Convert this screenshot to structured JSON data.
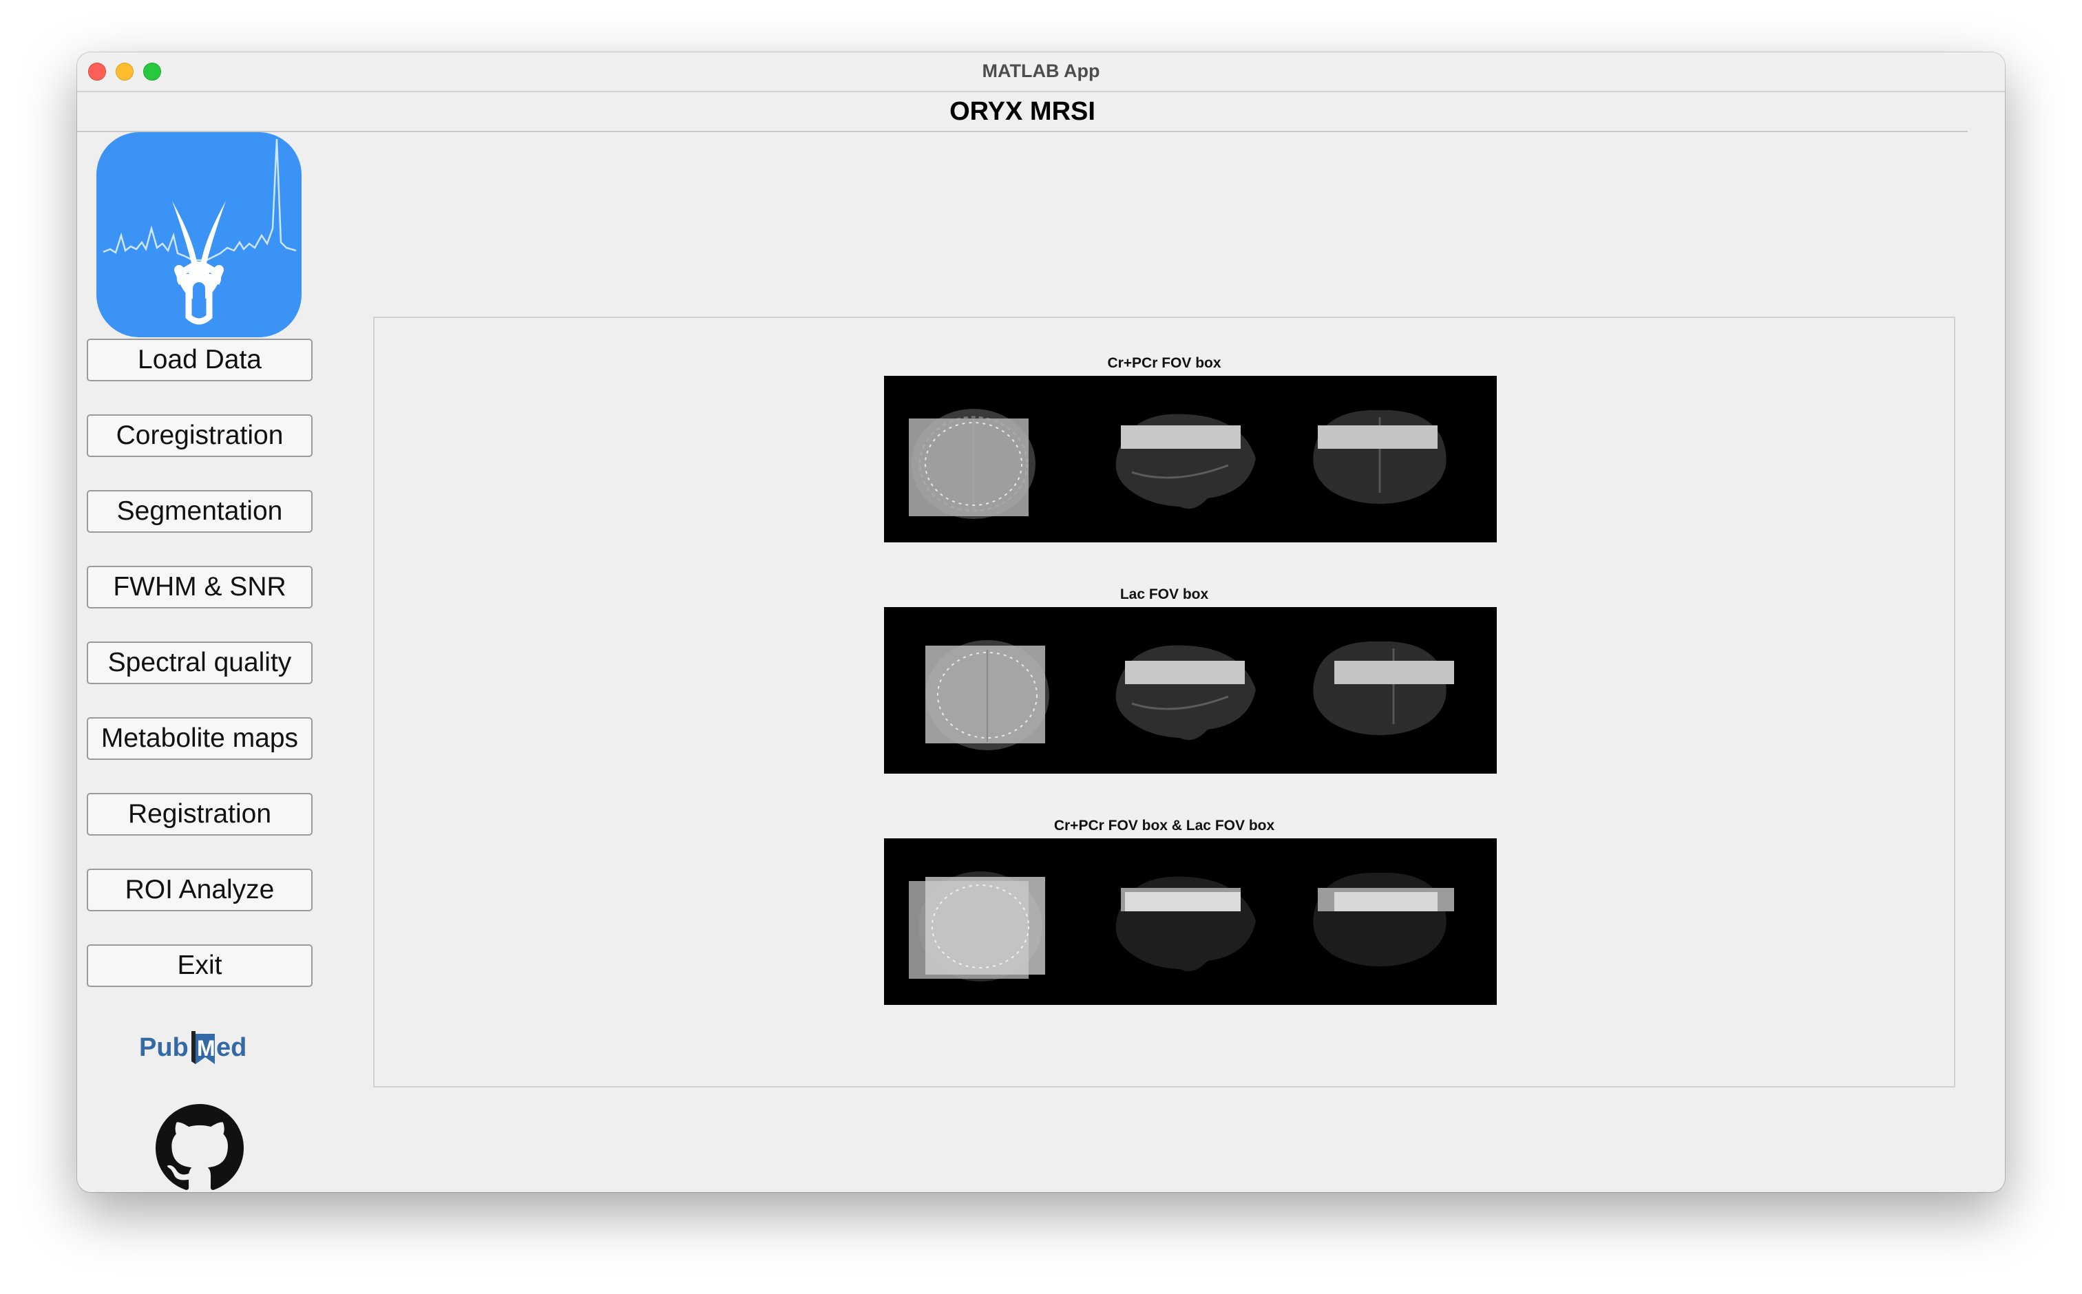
{
  "window": {
    "title": "MATLAB App"
  },
  "app": {
    "header": "ORYX MRSI"
  },
  "sidebar": {
    "buttons": [
      {
        "label": "Load Data"
      },
      {
        "label": "Coregistration"
      },
      {
        "label": "Segmentation"
      },
      {
        "label": "FWHM & SNR"
      },
      {
        "label": "Spectral quality"
      },
      {
        "label": "Metabolite maps"
      },
      {
        "label": "Registration"
      },
      {
        "label": "ROI Analyze"
      },
      {
        "label": "Exit"
      }
    ],
    "logo_icon": "oryx-spectrum-logo-icon",
    "pubmed": {
      "icon": "pubmed-logo-icon",
      "text": "PubMed"
    },
    "github": {
      "icon": "github-icon"
    }
  },
  "plots": [
    {
      "title": "Cr+PCr FOV box"
    },
    {
      "title": "Lac FOV box"
    },
    {
      "title": "Cr+PCr FOV box & Lac FOV box"
    }
  ],
  "colors": {
    "logo_bg": "#3b93f6",
    "window_bg": "#efefef",
    "plot_bg": "#000000",
    "pubmed_blue": "#336aa6"
  }
}
